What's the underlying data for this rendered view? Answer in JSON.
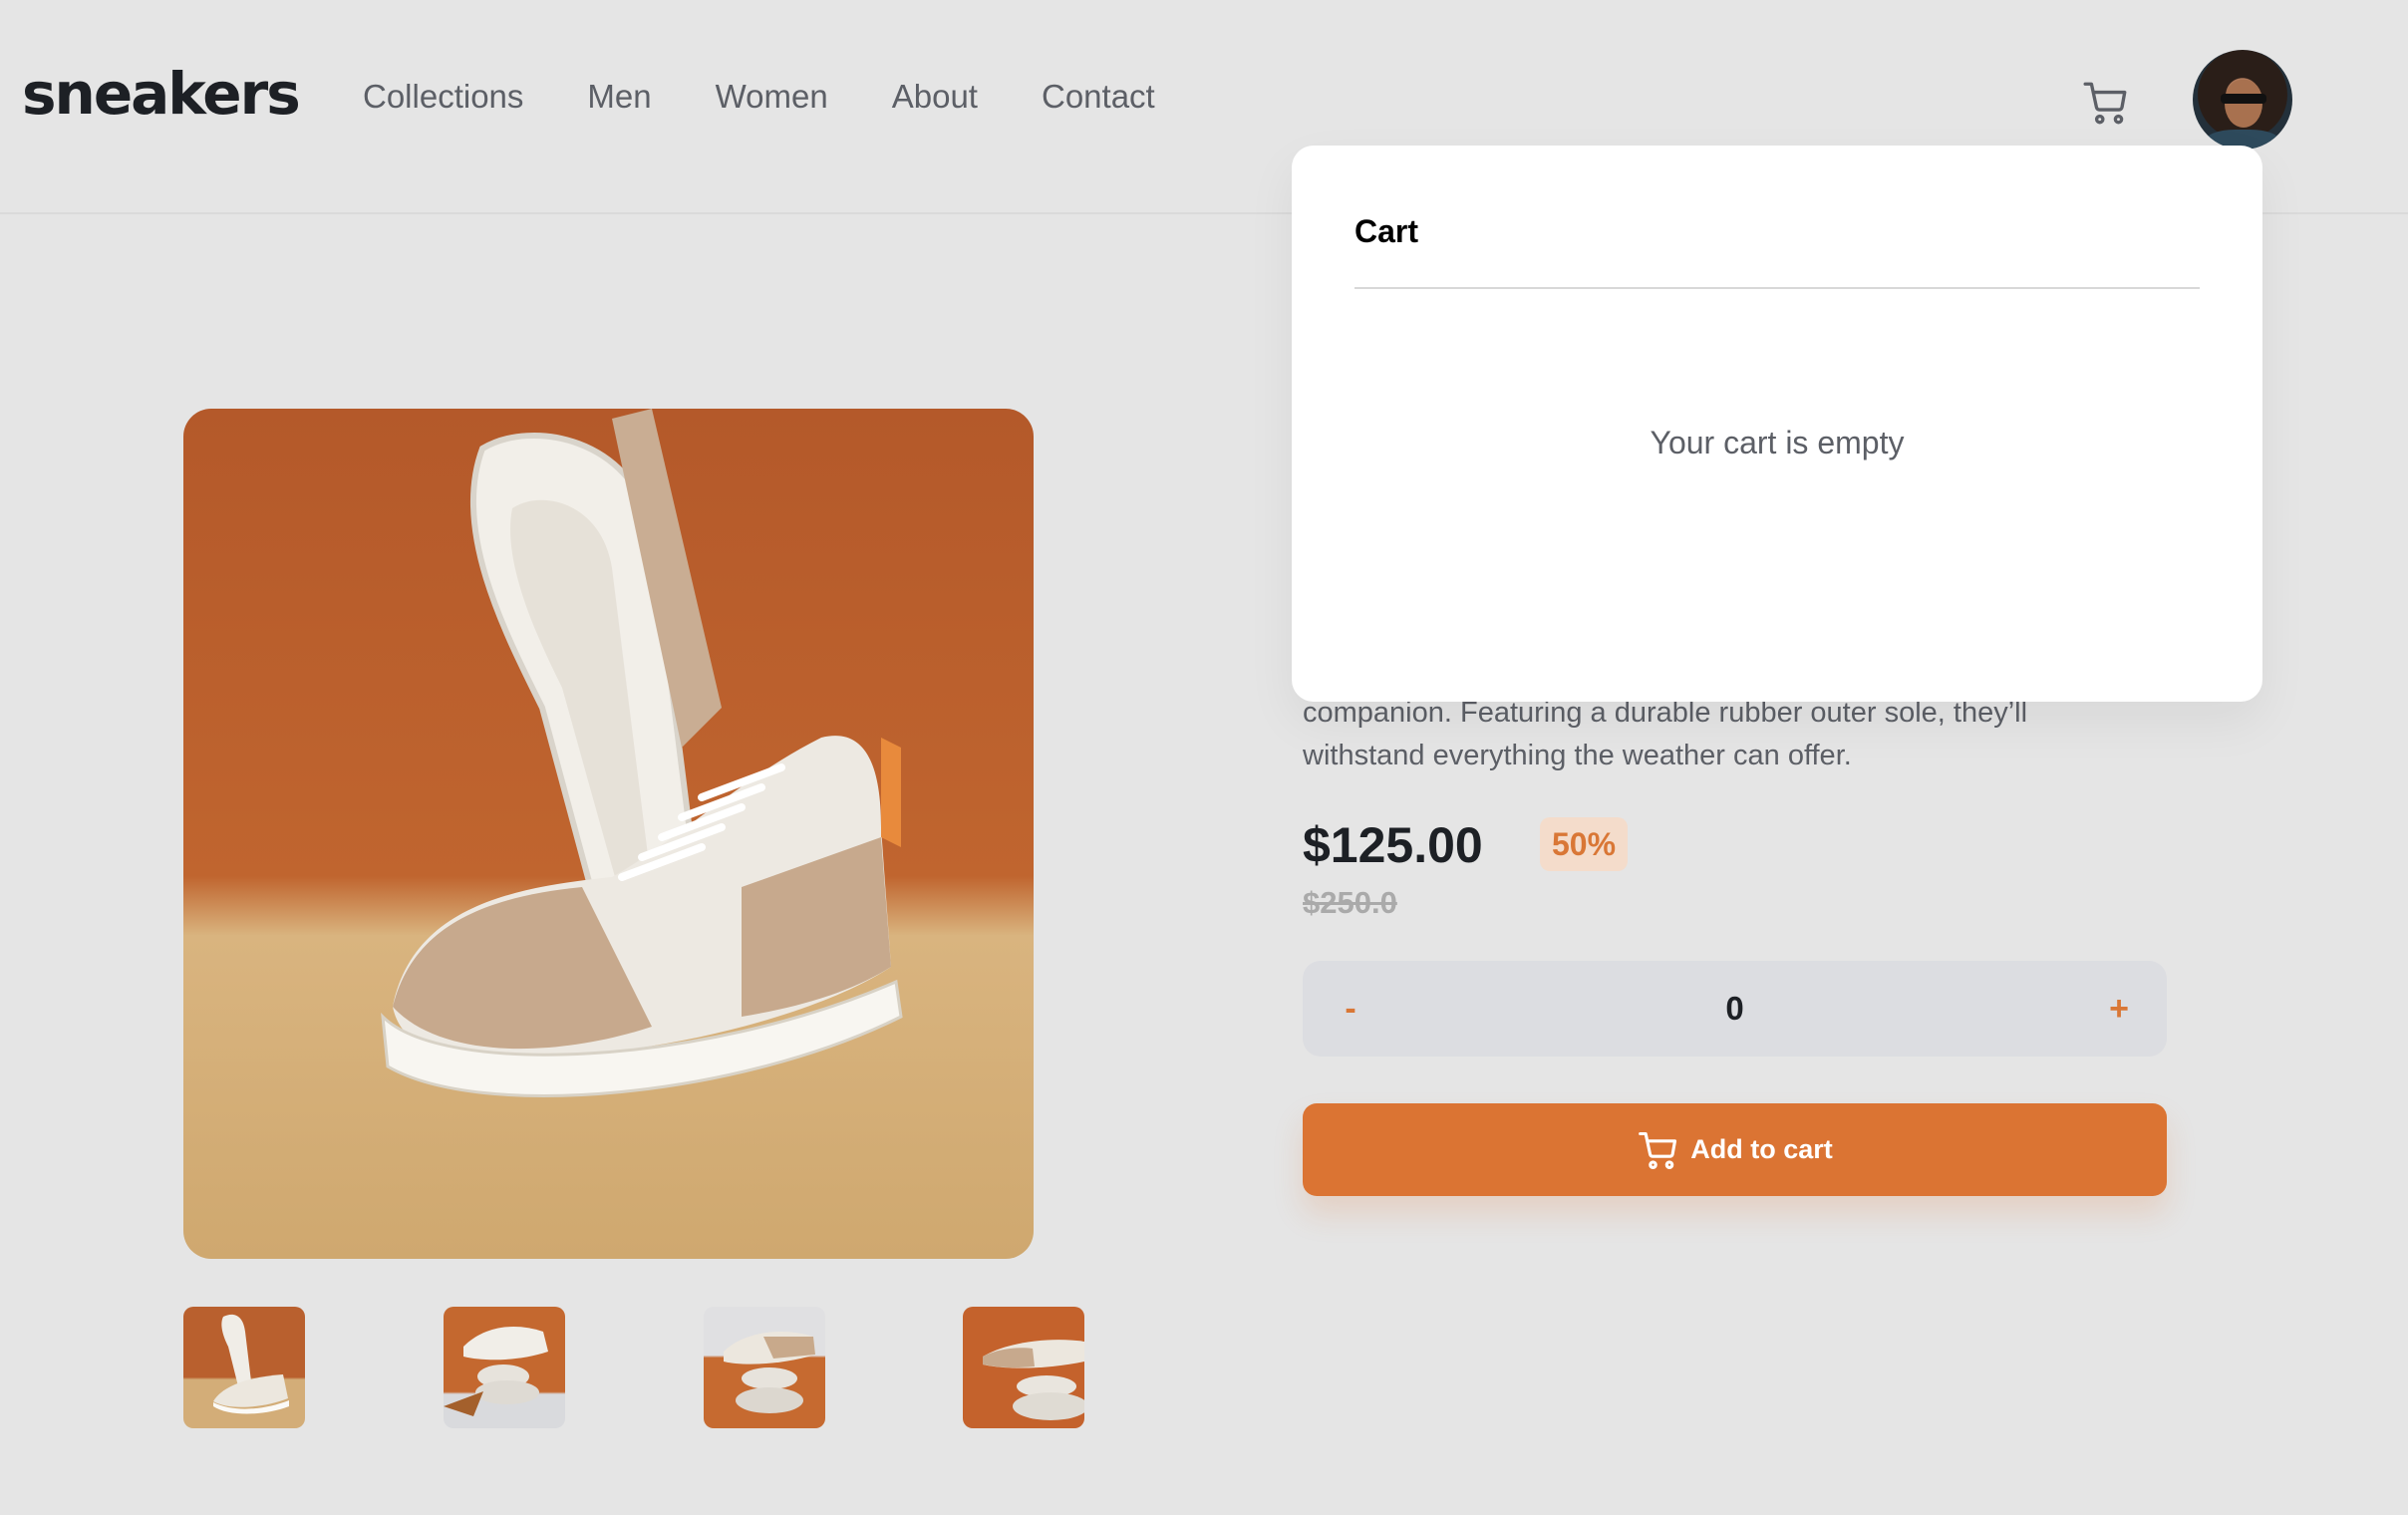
{
  "brand": {
    "logo": "sneakers"
  },
  "nav": {
    "items": [
      "Collections",
      "Men",
      "Women",
      "About",
      "Contact"
    ]
  },
  "header": {
    "cart_icon": "cart-icon",
    "avatar": "user-avatar"
  },
  "gallery": {
    "main_image": "sneaker-main-image",
    "thumbnails": [
      "thumbnail-1",
      "thumbnail-2",
      "thumbnail-3",
      "thumbnail-4"
    ]
  },
  "product": {
    "description_partial": "companion. Featuring a durable rubber outer sole, they’ll withstand everything the weather can offer.",
    "price": "$125.00",
    "discount": "50%",
    "original_price": "$250.0",
    "quantity": {
      "minus": "-",
      "value": "0",
      "plus": "+"
    },
    "add_to_cart": "Add to cart"
  },
  "cart_popup": {
    "title": "Cart",
    "empty_message": "Your cart is empty"
  },
  "colors": {
    "accent": "#db7433",
    "background": "#e5e5e5",
    "text": "#1d2025",
    "muted": "#5c5f66"
  }
}
